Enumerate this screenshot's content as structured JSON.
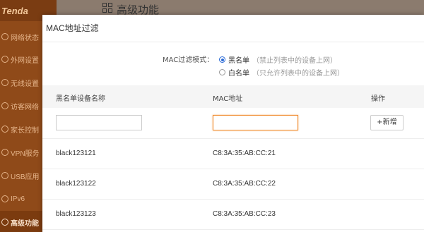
{
  "sidebar": {
    "logo": "Tenda",
    "items": [
      {
        "label": "网络状态"
      },
      {
        "label": "外网设置"
      },
      {
        "label": "无线设置"
      },
      {
        "label": "访客网络"
      },
      {
        "label": "家长控制"
      },
      {
        "label": "VPN服务"
      },
      {
        "label": "USB应用"
      },
      {
        "label": "IPv6"
      },
      {
        "label": "高级功能",
        "active": true
      }
    ]
  },
  "header": {
    "title": "高级功能"
  },
  "modal": {
    "title": "MAC地址过滤",
    "mode_label": "MAC过滤模式：",
    "options": [
      {
        "label": "黑名单",
        "note": "（禁止列表中的设备上网）",
        "selected": true
      },
      {
        "label": "白名单",
        "note": "（只允许列表中的设备上网）",
        "selected": false
      }
    ],
    "columns": [
      "黑名单设备名称",
      "MAC地址",
      "操作"
    ],
    "inputs": {
      "name_value": "",
      "mac_value": ""
    },
    "add_button": "+新增",
    "rows": [
      {
        "name": "black123121",
        "mac": "C8:3A:35:AB:CC:21"
      },
      {
        "name": "black123122",
        "mac": "C8:3A:35:AB:CC:22"
      },
      {
        "name": "black123123",
        "mac": "C8:3A:35:AB:CC:23"
      }
    ]
  },
  "colors": {
    "accent": "#f08a2c",
    "radio": "#2a6ad6",
    "sidebar": "#8f4a19"
  }
}
